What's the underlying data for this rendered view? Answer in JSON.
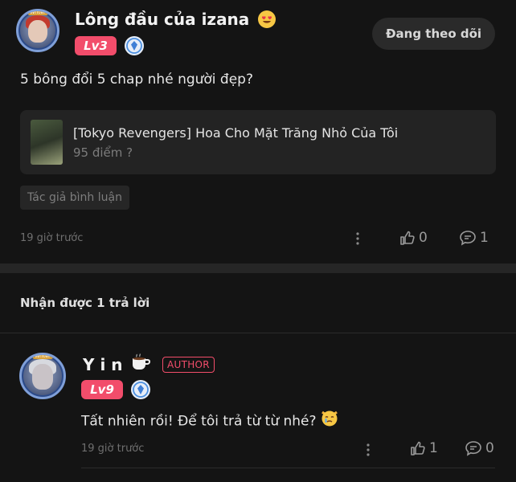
{
  "post": {
    "username": "Lông đầu của izana",
    "username_emoji": "heart-eyes-emoji",
    "avatar_tag": "Writer",
    "level": "Lv3",
    "follow_label": "Đang theo dõi",
    "text": "5 bông đổi 5 chap nhé người đẹp?",
    "story": {
      "title": "[Tokyo Revengers] Hoa Cho Mặt Trăng Nhỏ Của Tôi",
      "score": "95 điểm ?"
    },
    "tag": "Tác giả bình luận",
    "time": "19 giờ trước",
    "likes": "0",
    "comments": "1"
  },
  "replies": {
    "header": "Nhận được 1 trả lời",
    "items": [
      {
        "username": "Y i n",
        "username_emoji": "coffee-emoji",
        "avatar_tag": "Writer",
        "badge": "AUTHOR",
        "level": "Lv9",
        "text": "Tất nhiên rồi! Để tôi trả từ từ nhé?",
        "text_emoji": "crying-cat-emoji",
        "time": "19 giờ trước",
        "likes": "1",
        "comments": "0"
      }
    ]
  },
  "colors": {
    "background": "#141414",
    "level_badge": "#f24d6b",
    "card": "#232323",
    "muted_text": "#6f6f6f"
  }
}
